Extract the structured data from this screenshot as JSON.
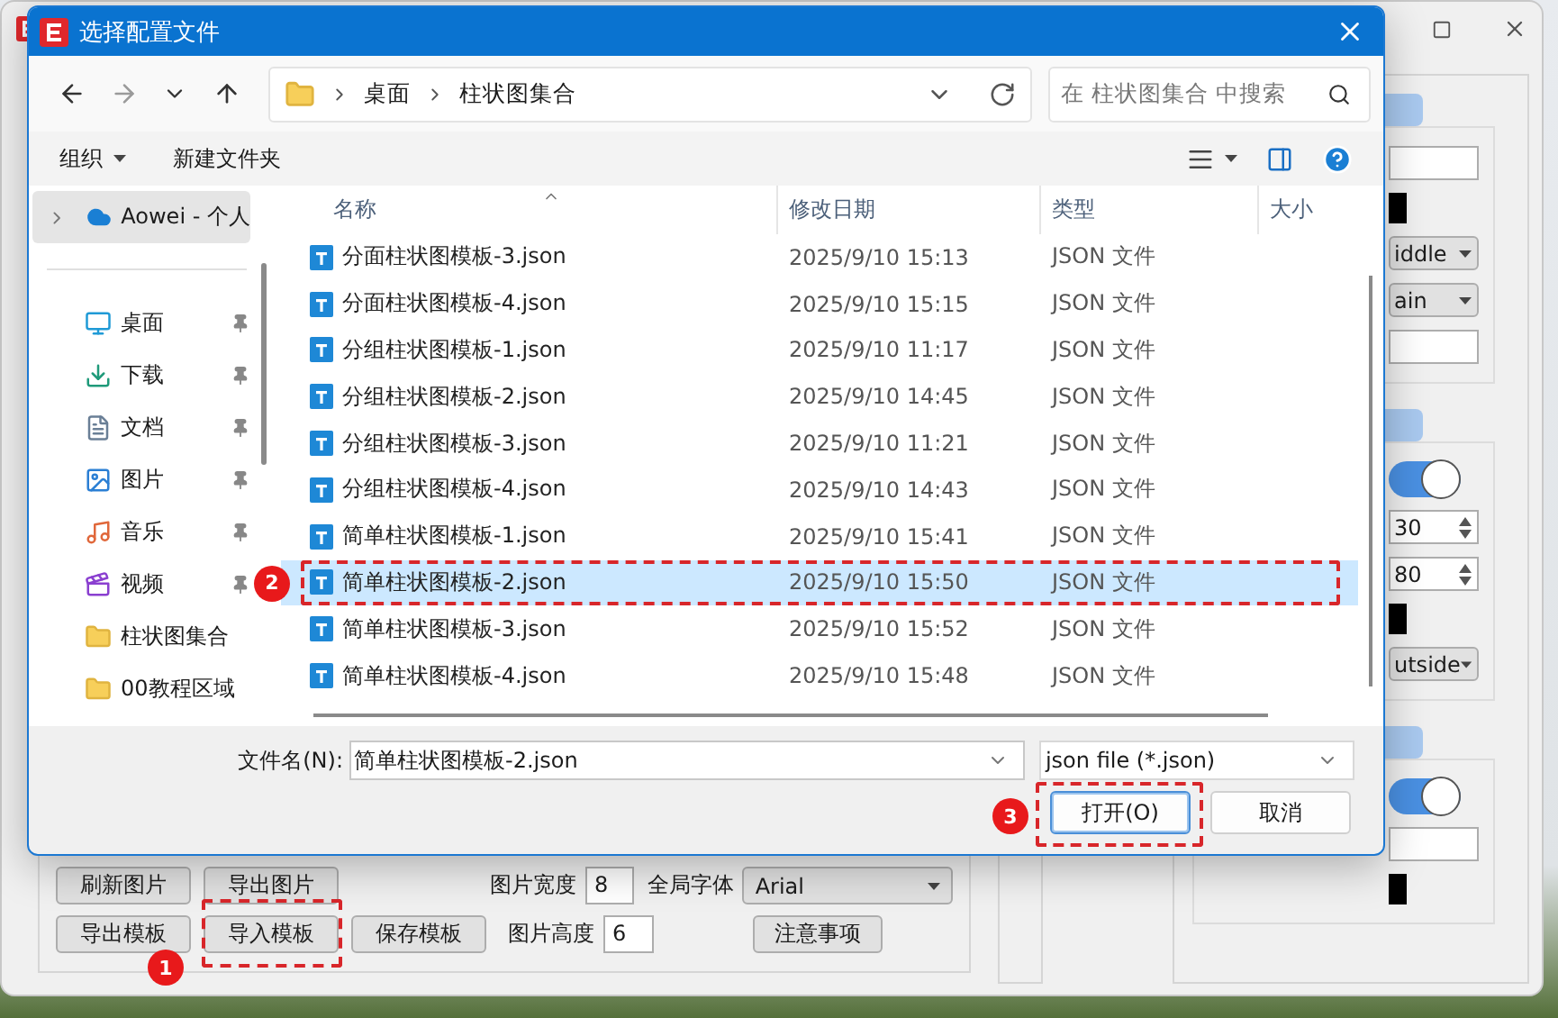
{
  "app": {
    "right_groups": [
      {
        "items": [
          {
            "kind": "input"
          },
          {
            "kind": "swatch"
          },
          {
            "kind": "dropdown",
            "value": "iddle"
          },
          {
            "kind": "dropdown",
            "value": "ain"
          },
          {
            "kind": "input"
          }
        ]
      },
      {
        "items": [
          {
            "kind": "switch",
            "on": true
          },
          {
            "kind": "spinner",
            "value": "30"
          },
          {
            "kind": "spinner",
            "value": "80"
          },
          {
            "kind": "swatch"
          },
          {
            "kind": "dropdown",
            "value": "utside"
          }
        ]
      },
      {
        "items": [
          {
            "kind": "switch",
            "on": true
          },
          {
            "kind": "input"
          },
          {
            "kind": "swatch"
          }
        ]
      }
    ],
    "bottom_panel": {
      "row_1": {
        "buttons": [
          {
            "label": "刷新图片"
          },
          {
            "label": "导出图片"
          }
        ],
        "size_label": "图片宽度",
        "size_value": "8",
        "font_label": "全局字体",
        "font_value": "Arial"
      },
      "row_2": {
        "buttons": [
          {
            "label": "导出模板"
          },
          {
            "label": "导入模板",
            "callout": "1"
          },
          {
            "label": "保存模板"
          }
        ],
        "size_label": "图片高度",
        "size_value": "6",
        "extra_button": "注意事项"
      }
    }
  },
  "dialog": {
    "title": "选择配置文件",
    "path": [
      "桌面",
      "柱状图集合"
    ],
    "search": {
      "placeholder": "在 柱状图集合 中搜索"
    },
    "toolbar": {
      "organize": "组织",
      "new_folder": "新建文件夹"
    },
    "sidebar": {
      "items": [
        {
          "label": "Aowei - 个人",
          "kind": "cloud",
          "selected": true,
          "pinned": false
        },
        {
          "label": "桌面",
          "kind": "desktop",
          "selected": false,
          "pinned": true
        },
        {
          "label": "下载",
          "kind": "download",
          "selected": false,
          "pinned": true
        },
        {
          "label": "文档",
          "kind": "documents",
          "selected": false,
          "pinned": true
        },
        {
          "label": "图片",
          "kind": "pictures",
          "selected": false,
          "pinned": true
        },
        {
          "label": "音乐",
          "kind": "music",
          "selected": false,
          "pinned": true
        },
        {
          "label": "视频",
          "kind": "videos",
          "selected": false,
          "pinned": true
        },
        {
          "label": "柱状图集合",
          "kind": "folder",
          "selected": false,
          "pinned": false
        },
        {
          "label": "00教程区域",
          "kind": "folder",
          "selected": false,
          "pinned": false
        }
      ]
    },
    "files": {
      "columns": [
        "名称",
        "修改日期",
        "类型",
        "大小"
      ],
      "rows": [
        {
          "name": "分面柱状图模板-3.json",
          "modified": "2025/9/10 15:13",
          "type": "JSON 文件",
          "selected": false
        },
        {
          "name": "分面柱状图模板-4.json",
          "modified": "2025/9/10 15:15",
          "type": "JSON 文件",
          "selected": false
        },
        {
          "name": "分组柱状图模板-1.json",
          "modified": "2025/9/10 11:17",
          "type": "JSON 文件",
          "selected": false
        },
        {
          "name": "分组柱状图模板-2.json",
          "modified": "2025/9/10 14:45",
          "type": "JSON 文件",
          "selected": false
        },
        {
          "name": "分组柱状图模板-3.json",
          "modified": "2025/9/10 11:21",
          "type": "JSON 文件",
          "selected": false
        },
        {
          "name": "分组柱状图模板-4.json",
          "modified": "2025/9/10 14:43",
          "type": "JSON 文件",
          "selected": false
        },
        {
          "name": "简单柱状图模板-1.json",
          "modified": "2025/9/10 15:41",
          "type": "JSON 文件",
          "selected": false
        },
        {
          "name": "简单柱状图模板-2.json",
          "modified": "2025/9/10 15:50",
          "type": "JSON 文件",
          "selected": true,
          "callout": "2"
        },
        {
          "name": "简单柱状图模板-3.json",
          "modified": "2025/9/10 15:52",
          "type": "JSON 文件",
          "selected": false
        },
        {
          "name": "简单柱状图模板-4.json",
          "modified": "2025/9/10 15:48",
          "type": "JSON 文件",
          "selected": false
        }
      ]
    },
    "file_name": {
      "label": "文件名(N):",
      "value": "简单柱状图模板-2.json"
    },
    "filter": "json file (*.json)",
    "buttons": [
      {
        "label": "打开(O)",
        "kind": "primary",
        "callout": "3"
      },
      {
        "label": "取消",
        "kind": "secondary"
      }
    ]
  }
}
